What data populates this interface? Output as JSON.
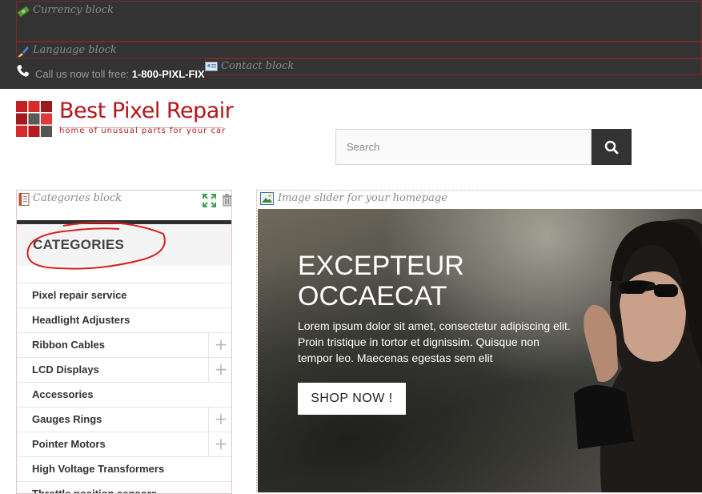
{
  "topbar": {
    "currency_block_label": "Currency block",
    "language_block_label": "Language block",
    "contact_block_label": "Contact block",
    "call_text": "Call us now toll free:",
    "phone_number": "1-800-PIXL-FIX",
    "icons": [
      "money-icon",
      "brush-icon",
      "contact-card-icon",
      "phone-icon"
    ]
  },
  "logo": {
    "title": "Best Pixel Repair",
    "tagline": "home of unusual parts for your car",
    "brand_color": "#b3161c"
  },
  "search": {
    "placeholder": "Search",
    "icon": "search-icon"
  },
  "categories": {
    "block_label": "Categories block",
    "title": "CATEGORIES",
    "items": [
      {
        "label": "Pixel repair service",
        "expandable": false
      },
      {
        "label": "Headlight Adjusters",
        "expandable": false
      },
      {
        "label": "Ribbon Cables",
        "expandable": true
      },
      {
        "label": "LCD Displays",
        "expandable": true
      },
      {
        "label": "Accessories",
        "expandable": false
      },
      {
        "label": "Gauges Rings",
        "expandable": true
      },
      {
        "label": "Pointer Motors",
        "expandable": true
      },
      {
        "label": "High Voltage Transformers",
        "expandable": false
      },
      {
        "label": "Throttle position sensors",
        "expandable": false
      }
    ],
    "expand_symbol": "+"
  },
  "slider": {
    "block_label": "Image slider for your homepage",
    "title": "EXCEPTEUR OCCAECAT",
    "text": "Lorem ipsum dolor sit amet, consectetur adipiscing elit. Proin tristique in tortor et dignissim. Quisque non tempor leo. Maecenas egestas sem elit",
    "button_label": "SHOP NOW !"
  }
}
